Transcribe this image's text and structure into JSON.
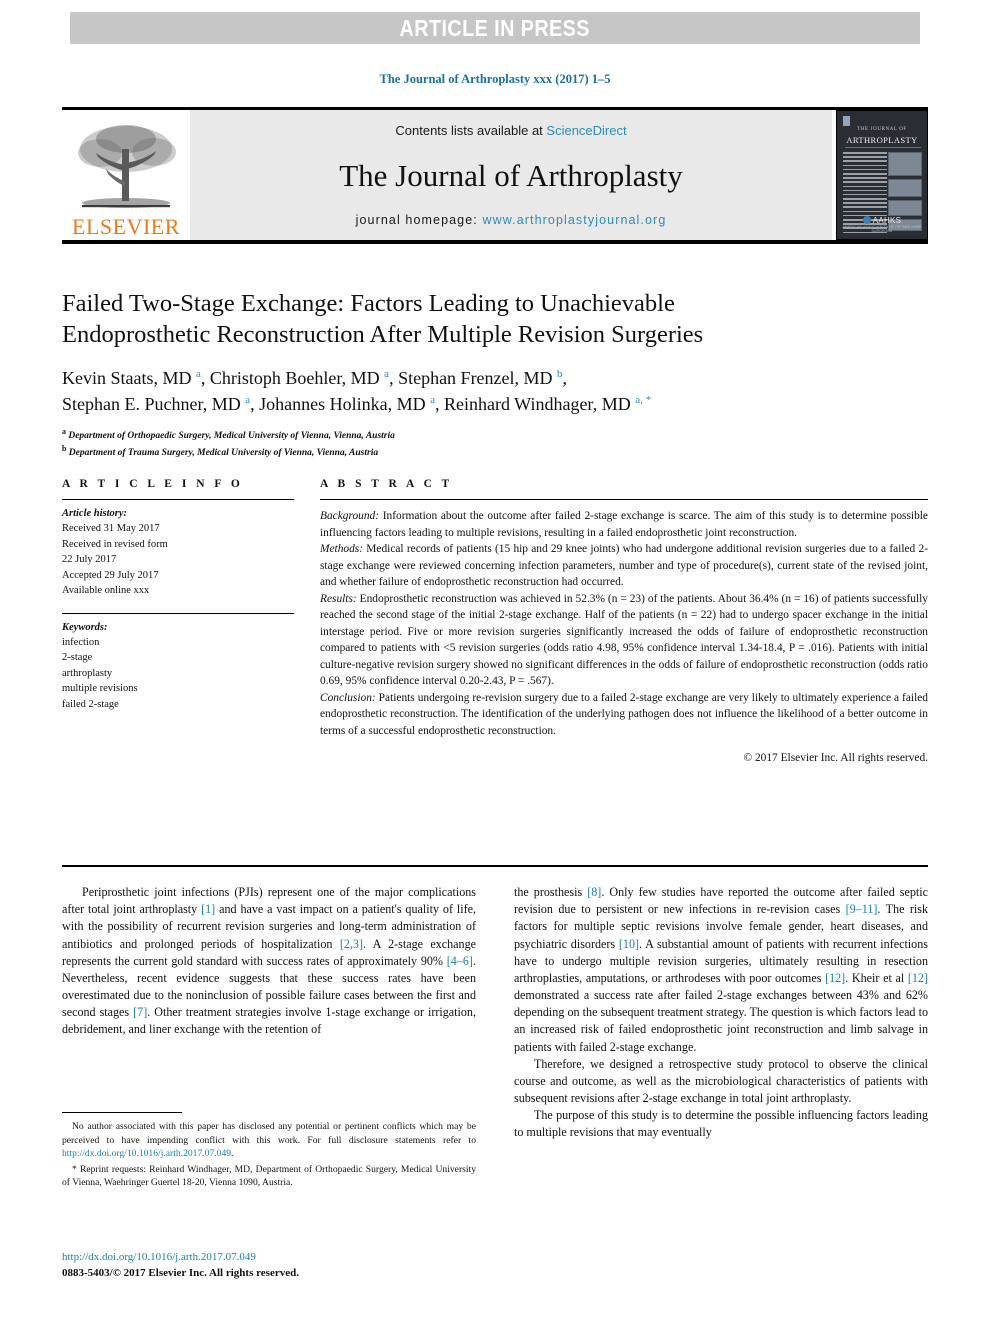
{
  "banner": {
    "text": "ARTICLE IN PRESS"
  },
  "citation_line": "The Journal of Arthroplasty xxx (2017) 1–5",
  "masthead": {
    "publisher_logo_label": "ELSEVIER",
    "contents_prefix": "Contents lists available at ",
    "contents_link": "ScienceDirect",
    "journal_name": "The Journal of Arthroplasty",
    "homepage_prefix": "journal homepage: ",
    "homepage_url": "www.arthroplastyjournal.org",
    "cover": {
      "sub": "THE JOURNAL OF",
      "title": "ARTHROPLASTY",
      "society": "AAHKS",
      "society_sub": "AMERICAN ASSOCIATION OF HIP AND KNEE SURGEONS"
    }
  },
  "article": {
    "title_line1": "Failed Two-Stage Exchange: Factors Leading to Unachievable",
    "title_line2": "Endoprosthetic Reconstruction After Multiple Revision Surgeries",
    "authors_line1": "Kevin Staats, MD a, Christoph Boehler, MD a, Stephan Frenzel, MD b,",
    "authors_line2": "Stephan E. Puchner, MD a, Johannes Holinka, MD a, Reinhard Windhager, MD a, *",
    "authors": [
      {
        "name": "Kevin Staats, MD",
        "marks": "a"
      },
      {
        "name": "Christoph Boehler, MD",
        "marks": "a"
      },
      {
        "name": "Stephan Frenzel, MD",
        "marks": "b"
      },
      {
        "name": "Stephan E. Puchner, MD",
        "marks": "a"
      },
      {
        "name": "Johannes Holinka, MD",
        "marks": "a"
      },
      {
        "name": "Reinhard Windhager, MD",
        "marks": "a, *"
      }
    ],
    "affiliations": [
      {
        "mark": "a",
        "text": "Department of Orthopaedic Surgery, Medical University of Vienna, Vienna, Austria"
      },
      {
        "mark": "b",
        "text": "Department of Trauma Surgery, Medical University of Vienna, Vienna, Austria"
      }
    ]
  },
  "info": {
    "heading": "A R T I C L E   I N F O",
    "history_label": "Article history:",
    "history": [
      "Received 31 May 2017",
      "Received in revised form",
      "22 July 2017",
      "Accepted 29 July 2017",
      "Available online xxx"
    ],
    "keywords_label": "Keywords:",
    "keywords": [
      "infection",
      "2-stage",
      "arthroplasty",
      "multiple revisions",
      "failed 2-stage"
    ]
  },
  "abstract": {
    "heading": "A B S T R A C T",
    "background_label": "Background:",
    "background": "Information about the outcome after failed 2-stage exchange is scarce. The aim of this study is to determine possible influencing factors leading to multiple revisions, resulting in a failed endoprosthetic joint reconstruction.",
    "methods_label": "Methods:",
    "methods": "Medical records of patients (15 hip and 29 knee joints) who had undergone additional revision surgeries due to a failed 2-stage exchange were reviewed concerning infection parameters, number and type of procedure(s), current state of the revised joint, and whether failure of endoprosthetic reconstruction had occurred.",
    "results_label": "Results:",
    "results": "Endoprosthetic reconstruction was achieved in 52.3% (n = 23) of the patients. About 36.4% (n = 16) of patients successfully reached the second stage of the initial 2-stage exchange. Half of the patients (n = 22) had to undergo spacer exchange in the initial interstage period. Five or more revision surgeries significantly increased the odds of failure of endoprosthetic reconstruction compared to patients with <5 revision surgeries (odds ratio 4.98, 95% confidence interval 1.34-18.4, P = .016). Patients with initial culture-negative revision surgery showed no significant differences in the odds of failure of endoprosthetic reconstruction (odds ratio 0.69, 95% confidence interval 0.20-2.43, P = .567).",
    "conclusion_label": "Conclusion:",
    "conclusion": "Patients undergoing re-revision surgery due to a failed 2-stage exchange are very likely to ultimately experience a failed endoprosthetic reconstruction. The identification of the underlying pathogen does not influence the likelihood of a better outcome in terms of a successful endoprosthetic reconstruction.",
    "copyright": "© 2017 Elsevier Inc. All rights reserved."
  },
  "body": {
    "left_para1_a": "Periprosthetic joint infections (PJIs) represent one of the major complications after total joint arthroplasty ",
    "left_para1_r1": "[1]",
    "left_para1_b": " and have a vast impact on a patient's quality of life, with the possibility of recurrent revision surgeries and long-term administration of antibiotics and prolonged periods of hospitalization ",
    "left_para1_r2": "[2,3]",
    "left_para1_c": ". A 2-stage exchange represents the current gold standard with success rates of approximately 90% ",
    "left_para1_r3": "[4–6]",
    "left_para1_d": ". Nevertheless, recent evidence suggests that these success rates have been overestimated due to the noninclusion of possible failure cases between the first and second stages ",
    "left_para1_r4": "[7]",
    "left_para1_e": ". Other treatment strategies involve 1-stage exchange or irrigation, debridement, and liner exchange with the retention of",
    "right_para1_a": "the prosthesis ",
    "right_para1_r1": "[8]",
    "right_para1_b": ". Only few studies have reported the outcome after failed septic revision due to persistent or new infections in re-revision cases ",
    "right_para1_r2": "[9–11]",
    "right_para1_c": ". The risk factors for multiple septic revisions involve female gender, heart diseases, and psychiatric disorders ",
    "right_para1_r3": "[10]",
    "right_para1_d": ". A substantial amount of patients with recurrent infections have to undergo multiple revision surgeries, ultimately resulting in resection arthroplasties, amputations, or arthrodeses with poor outcomes ",
    "right_para1_r4": "[12]",
    "right_para1_e": ". Kheir et al ",
    "right_para1_r5": "[12]",
    "right_para1_f": " demonstrated a success rate after failed 2-stage exchanges between 43% and 62% depending on the subsequent treatment strategy. The question is which factors lead to an increased risk of failed endoprosthetic joint reconstruction and limb salvage in patients with failed 2-stage exchange.",
    "right_para2": "Therefore, we designed a retrospective study protocol to observe the clinical course and outcome, as well as the microbiological characteristics of patients with subsequent revisions after 2-stage exchange in total joint arthroplasty.",
    "right_para3": "The purpose of this study is to determine the possible influencing factors leading to multiple revisions that may eventually"
  },
  "footnotes": {
    "disclosure_a": "No author associated with this paper has disclosed any potential or pertinent conflicts which may be perceived to have impending conflict with this work. For full disclosure statements refer to ",
    "disclosure_link": "http://dx.doi.org/10.1016/j.arth.2017.07.049",
    "disclosure_b": ".",
    "reprint": "* Reprint requests: Reinhard Windhager, MD, Department of Orthopaedic Surgery, Medical University of Vienna, Waehringer Guertel 18-20, Vienna 1090, Austria.",
    "doi": "http://dx.doi.org/10.1016/j.arth.2017.07.049",
    "issn": "0883-5403/© 2017 Elsevier Inc. All rights reserved."
  },
  "colors": {
    "link": "#1a7fae",
    "banner_bg": "#c6c6c6",
    "masthead_bg": "#e9e9e9",
    "elsevier_orange": "#e87b1e"
  }
}
